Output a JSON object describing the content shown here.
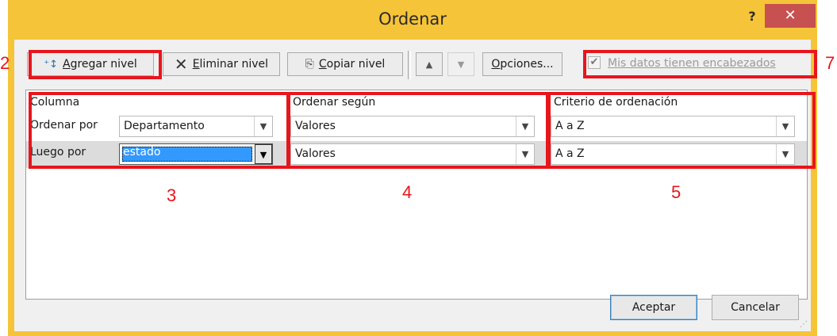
{
  "window": {
    "title": "Ordenar",
    "help": "?",
    "close": "✕"
  },
  "toolbar": {
    "add_level": {
      "prefix": "",
      "accel": "A",
      "rest": "gregar nivel"
    },
    "delete_level": {
      "accel": "E",
      "rest": "liminar nivel"
    },
    "copy_level": {
      "accel": "C",
      "rest": "opiar nivel"
    },
    "move_up": "▲",
    "move_down": "▼",
    "options": {
      "accel": "O",
      "rest": "pciones..."
    },
    "headers_checkbox": {
      "checked": true,
      "check": "✔",
      "label": "Mis datos tienen encabezados"
    }
  },
  "grid": {
    "headers": {
      "column": "Columna",
      "sort_on": "Ordenar según",
      "order": "Criterio de ordenación"
    },
    "rows": [
      {
        "label": "Ordenar por",
        "column": "Departamento",
        "sort_on": "Valores",
        "order": "A a Z"
      },
      {
        "label": "Luego por",
        "column": "estado",
        "sort_on": "Valores",
        "order": "A a Z"
      }
    ]
  },
  "footer": {
    "ok": "Aceptar",
    "cancel": "Cancelar"
  },
  "annotations": {
    "n2": "2",
    "n3": "3",
    "n4": "4",
    "n5": "5",
    "n7": "7"
  },
  "colors": {
    "frame": "#f5c438",
    "close": "#c75050",
    "highlight": "#e8151c",
    "selection": "#3399ff"
  }
}
